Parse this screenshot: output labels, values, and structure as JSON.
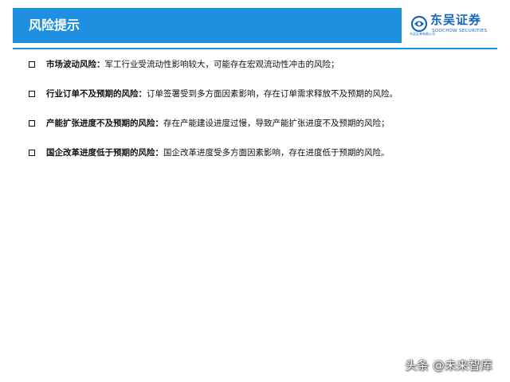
{
  "header": {
    "title": "风险提示",
    "logo": {
      "cn": "东吴证券",
      "en": "SOOCHOW SECURITIES",
      "small": "东吴证券有限公司",
      "accent": "#1566b8"
    },
    "bar_color": "#1f8fe0"
  },
  "risks": [
    {
      "title": "市场波动风险",
      "sep": "：",
      "body": "军工行业受流动性影响较大，可能存在宏观流动性冲击的风险；"
    },
    {
      "title": "行业订单不及预期的风险",
      "sep": "：",
      "body": "订单签署受到多方面因素影响，存在订单需求释放不及预期的风险。"
    },
    {
      "title": "产能扩张进度不及预期的风险",
      "sep": "：",
      "body": "存在产能建设进度过慢，导致产能扩张进度不及预期的风险；"
    },
    {
      "title": "国企改革进度低于预期的风险",
      "sep": "：",
      "body": "国企改革进度受多方面因素影响，存在进度低于预期的风险。"
    }
  ],
  "watermark": "头条 @未来智库"
}
